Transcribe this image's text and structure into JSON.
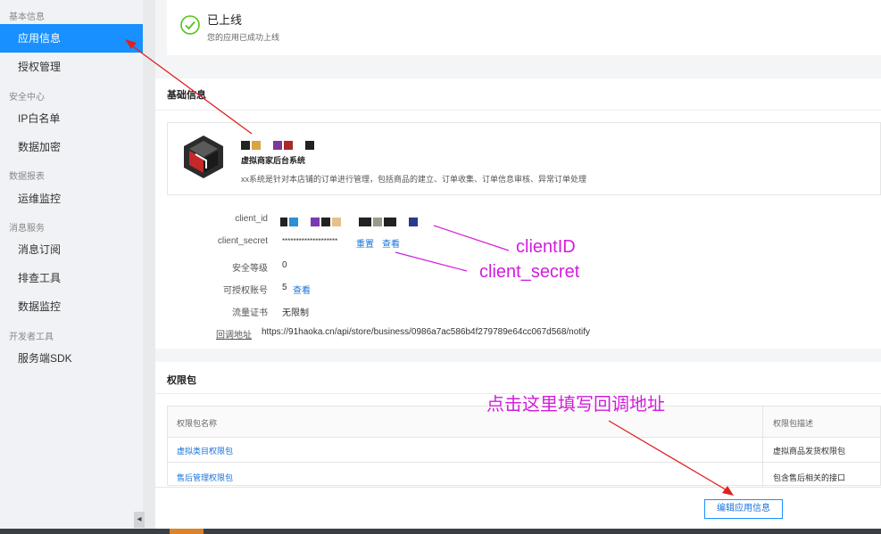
{
  "sidebar": {
    "groups": [
      {
        "label": "基本信息"
      },
      {
        "label": "安全中心"
      },
      {
        "label": "数据报表"
      },
      {
        "label": "消息服务"
      },
      {
        "label": "开发者工具"
      }
    ],
    "items": [
      {
        "label": "应用信息"
      },
      {
        "label": "授权管理"
      },
      {
        "label": "IP白名单"
      },
      {
        "label": "数据加密"
      },
      {
        "label": "运维监控"
      },
      {
        "label": "消息订阅"
      },
      {
        "label": "排查工具"
      },
      {
        "label": "数据监控"
      },
      {
        "label": "服务端SDK"
      }
    ],
    "collapse_glyph": "◂"
  },
  "status": {
    "title": "已上线",
    "subtitle": "您的应用已成功上线"
  },
  "basic": {
    "section_title": "基础信息",
    "app_name": "虚拟商家后台系统",
    "app_desc": "xx系统是针对本店铺的订单进行管理，包括商品的建立、订单收集、订单信息审核、异常订单处理",
    "fields": {
      "client_id_label": "client_id",
      "client_secret_label": "client_secret",
      "client_secret_value": "********************",
      "reset_link": "重置",
      "view_link": "查看",
      "security_label": "安全等级",
      "security_value": "0",
      "auth_label": "可授权账号",
      "auth_value": "5",
      "auth_view": "查看",
      "traffic_label": "流量证书",
      "traffic_value": "无限制",
      "callback_label": "回调地址",
      "callback_value": "https://91haoka.cn/api/store/business/0986a7ac586b4f279789e64cc067d568/notify"
    }
  },
  "permissions": {
    "section_title": "权限包",
    "col_name": "权限包名称",
    "col_desc": "权限包描述",
    "rows": [
      {
        "name": "虚拟类目权限包",
        "desc": "虚拟商品发货权限包"
      },
      {
        "name": "售后管理权限包",
        "desc": "包含售后相关的接口"
      }
    ]
  },
  "edit_button": "编辑应用信息",
  "annotations": {
    "client_id": "clientID",
    "client_secret": "client_secret",
    "fill_callback": "点击这里填写回调地址",
    "color": "#d21ddc"
  },
  "colors": {
    "accent": "#1890ff",
    "link": "#1a73d9",
    "success": "#52c41a",
    "annotation": "#d21ddc",
    "arrow": "#e02020"
  }
}
